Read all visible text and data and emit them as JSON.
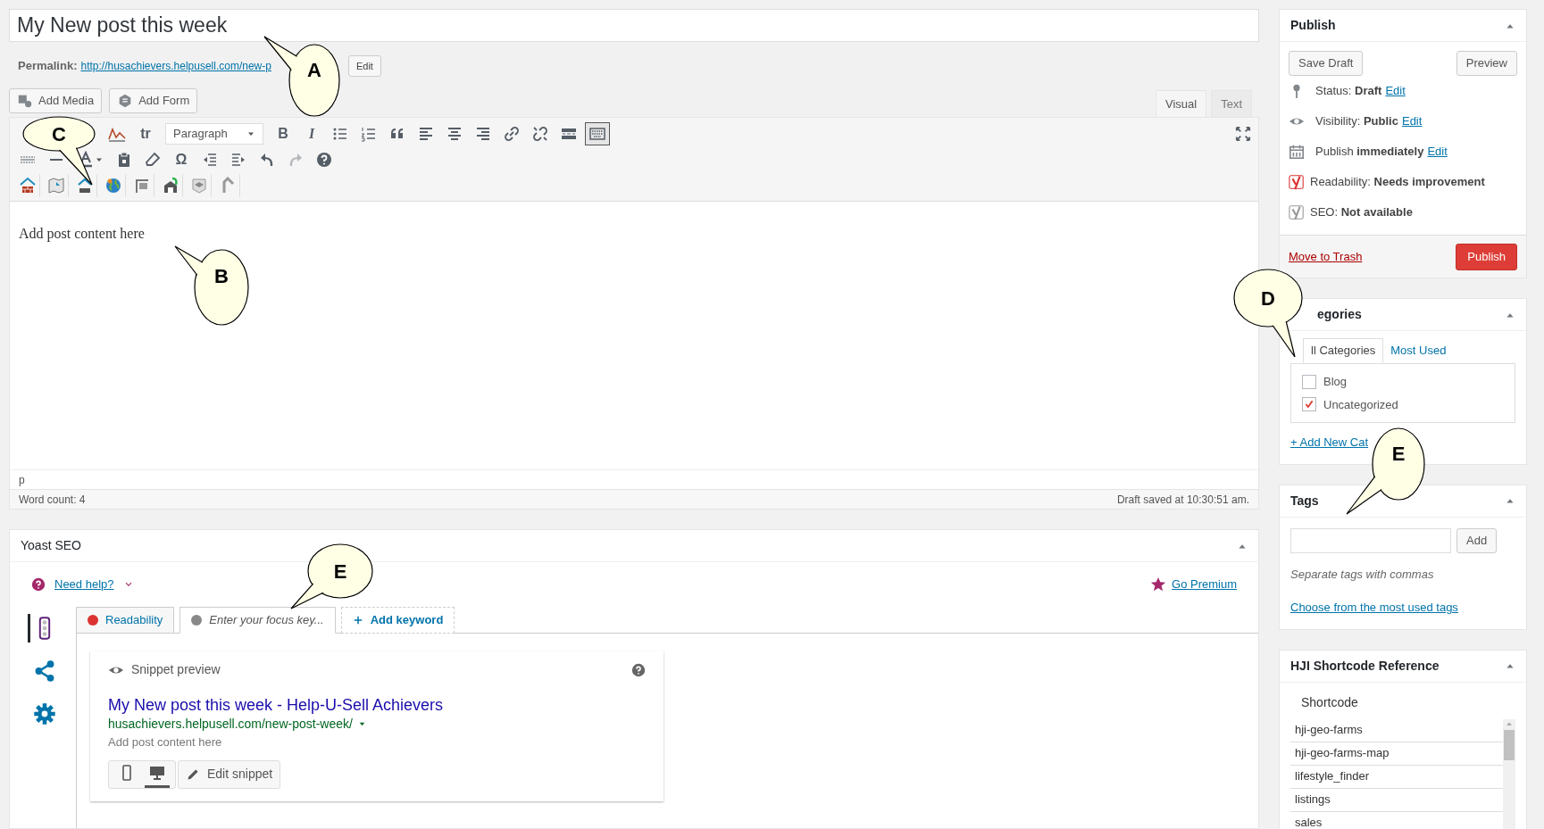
{
  "post_title": "My New post this week",
  "permalink": {
    "label": "Permalink:",
    "url": "http://husachievers.helpusell.com/new-p",
    "edit": "Edit"
  },
  "media_buttons": [
    {
      "kind": "media",
      "label": "Add Media"
    },
    {
      "kind": "form",
      "label": "Add Form"
    }
  ],
  "editor_tabs": [
    {
      "label": "Visual",
      "selected": true
    },
    {
      "label": "Text",
      "selected": false
    }
  ],
  "toolbar_rows": [
    [
      {
        "kind": "chart",
        "pressed": false
      },
      {
        "kind": "pin-text",
        "glyph": "tr",
        "pressed": false
      },
      {
        "kind": "select",
        "value": "Paragraph",
        "pressed": false
      },
      {
        "kind": "bold",
        "glyph": "B",
        "pressed": false
      },
      {
        "kind": "italic",
        "glyph": "I",
        "pressed": false
      },
      {
        "kind": "bullets",
        "pressed": false
      },
      {
        "kind": "numbers",
        "pressed": false
      },
      {
        "kind": "quote",
        "pressed": false
      },
      {
        "kind": "align-left",
        "pressed": false
      },
      {
        "kind": "align-center",
        "pressed": false
      },
      {
        "kind": "align-right",
        "pressed": false
      },
      {
        "kind": "link",
        "pressed": false
      },
      {
        "kind": "unlink",
        "pressed": false
      },
      {
        "kind": "more",
        "pressed": false
      },
      {
        "kind": "toolbar-toggle",
        "pressed": true
      }
    ],
    [
      {
        "kind": "strike",
        "disabled": false
      },
      {
        "kind": "rule",
        "disabled": false
      },
      {
        "kind": "text-color",
        "disabled": false
      },
      {
        "kind": "paste",
        "disabled": false
      },
      {
        "kind": "eraser",
        "disabled": false
      },
      {
        "kind": "omega",
        "glyph": "Ω",
        "disabled": false
      },
      {
        "kind": "outdent",
        "disabled": false
      },
      {
        "kind": "indent",
        "disabled": false
      },
      {
        "kind": "undo",
        "disabled": false
      },
      {
        "kind": "redo",
        "disabled": true
      },
      {
        "kind": "help",
        "disabled": false
      }
    ],
    [
      {
        "kind": "house"
      },
      {
        "kind": "map"
      },
      {
        "kind": "idx"
      },
      {
        "kind": "globe"
      },
      {
        "kind": "sign"
      },
      {
        "kind": "farm"
      },
      {
        "kind": "hat"
      },
      {
        "kind": "arrow"
      }
    ]
  ],
  "content": "Add post content here",
  "path": "p",
  "word_count": "Word count: 4",
  "draft_saved": "Draft saved at 10:30:51 am.",
  "yoast": {
    "title": "Yoast SEO",
    "help": "Need help?",
    "premium": "Go Premium",
    "side_nav": [
      {
        "kind": "readability",
        "selected": true
      },
      {
        "kind": "social",
        "selected": false
      },
      {
        "kind": "settings",
        "selected": false
      }
    ],
    "tabs": [
      {
        "kind": "analysis",
        "label": "Readability",
        "color": "#dc3232",
        "selected": false
      },
      {
        "kind": "keyword",
        "label": "Enter your focus key...",
        "color": "#888888",
        "selected": true
      },
      {
        "kind": "add",
        "label": "Add keyword",
        "selected": false
      }
    ],
    "snippet": {
      "heading": "Snippet preview",
      "title": "My New post this week - Help-U-Sell Achievers",
      "url": "husachievers.helpusell.com/new-post-week/",
      "description": "Add post content here",
      "modes": [
        {
          "kind": "mobile",
          "selected": false
        },
        {
          "kind": "desktop",
          "selected": true
        }
      ],
      "edit": "Edit snippet"
    }
  },
  "publish": {
    "title": "Publish",
    "save_draft": "Save Draft",
    "preview": "Preview",
    "rows": [
      {
        "kind": "status",
        "label": "Status:",
        "value": "Draft",
        "link": "Edit"
      },
      {
        "kind": "visibility",
        "label": "Visibility:",
        "value": "Public",
        "link": "Edit"
      },
      {
        "kind": "schedule",
        "label": "Publish",
        "value": "immediately",
        "link": "Edit"
      },
      {
        "kind": "readability",
        "label": "Readability:",
        "value": "Needs improvement"
      },
      {
        "kind": "seo",
        "label": "SEO:",
        "value": "Not available"
      }
    ],
    "trash": "Move to Trash",
    "publish_button": "Publish"
  },
  "categories": {
    "title": "egories",
    "tabs": [
      {
        "label": "ll Categories",
        "selected": true
      },
      {
        "label": "Most Used",
        "selected": false
      }
    ],
    "items": [
      {
        "label": "Blog",
        "checked": false
      },
      {
        "label": "Uncategorized",
        "checked": true
      }
    ],
    "add_new": "+ Add New Cat"
  },
  "tags": {
    "title": "Tags",
    "add": "Add",
    "hint": "Separate tags with commas",
    "choose": "Choose from the most used tags"
  },
  "shortcodes": {
    "title": "HJI Shortcode Reference",
    "header": "Shortcode",
    "rows": [
      "hji-geo-farms",
      "hji-geo-farms-map",
      "lifestyle_finder",
      "listings",
      "sales"
    ]
  },
  "callouts": [
    {
      "label": "A"
    },
    {
      "label": "C"
    },
    {
      "label": "B"
    },
    {
      "label": "D"
    },
    {
      "label": "E"
    },
    {
      "label": "E"
    }
  ]
}
